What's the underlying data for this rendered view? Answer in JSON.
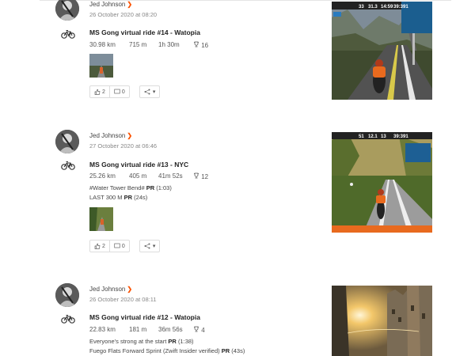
{
  "feed": [
    {
      "athlete_name": "Jed Johnson",
      "date": "26 October 2020 at 08:20",
      "sport_icon": "bike-icon",
      "title": "MS Gong virtual ride #14 - Watopia",
      "distance": "30.98 km",
      "elevation": "715 m",
      "time": "1h 30m",
      "achievements": "16",
      "segments": [],
      "kudos": "2",
      "comments": "0"
    },
    {
      "athlete_name": "Jed Johnson",
      "date": "27 October 2020 at 06:46",
      "sport_icon": "bike-icon",
      "title": "MS Gong virtual ride #13 - NYC",
      "distance": "25.26 km",
      "elevation": "405 m",
      "time": "41m 52s",
      "achievements": "12",
      "segments": [
        {
          "name": "#Water Tower Bend#",
          "badge": "PR",
          "result": "(1:03)"
        },
        {
          "name": "LAST 300 M",
          "badge": "PR",
          "result": "(24s)"
        }
      ],
      "kudos": "2",
      "comments": "0"
    },
    {
      "athlete_name": "Jed Johnson",
      "date": "26 October 2020 at 08:11",
      "sport_icon": "bike-icon",
      "title": "MS Gong virtual ride #12 - Watopia",
      "distance": "22.83 km",
      "elevation": "181 m",
      "time": "36m 56s",
      "achievements": "4",
      "segments": [
        {
          "name": "Everyone's strong at the start",
          "badge": "PR",
          "result": "(1:38)"
        },
        {
          "name": "Fuego Flats Forward Sprint (Zwift Insider verified)",
          "badge": "PR",
          "result": "(43s)"
        }
      ]
    }
  ],
  "hud": {
    "card1": [
      "33",
      "31.3",
      "14:59",
      "39:391"
    ],
    "card2": [
      "51",
      "12.1",
      "13",
      "39:391"
    ]
  },
  "colors": {
    "accent": "#fc5200"
  }
}
